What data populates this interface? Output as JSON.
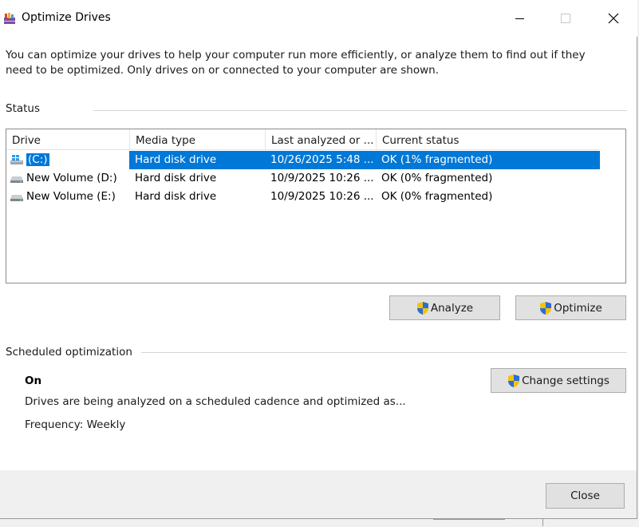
{
  "window": {
    "title": "Optimize Drives"
  },
  "intro": {
    "text": "You can optimize your drives to help your computer run more efficiently, or analyze them to find out if they need to be optimized. Only drives on or connected to your computer are shown."
  },
  "status": {
    "label": "Status",
    "columns": [
      "Drive",
      "Media type",
      "Last analyzed or ...",
      "Current status"
    ],
    "rows": [
      {
        "drive": "(C:)",
        "icon": "windows-drive-icon",
        "media": "Hard disk drive",
        "last": "10/26/2025 5:48 ...",
        "status": "OK (1% fragmented)",
        "selected": true
      },
      {
        "drive": "New Volume (D:)",
        "icon": "hard-drive-icon",
        "media": "Hard disk drive",
        "last": "10/9/2025 10:26 ...",
        "status": "OK (0% fragmented)",
        "selected": false
      },
      {
        "drive": "New Volume (E:)",
        "icon": "hard-drive-icon",
        "media": "Hard disk drive",
        "last": "10/9/2025 10:26 ...",
        "status": "OK (0% fragmented)",
        "selected": false
      }
    ]
  },
  "actions": {
    "analyze": "Analyze",
    "optimize": "Optimize"
  },
  "schedule": {
    "label": "Scheduled optimization",
    "state": "On",
    "description": "Drives are being analyzed on a scheduled cadence and optimized as...",
    "frequency": "Frequency: Weekly",
    "change_settings": "Change settings"
  },
  "footer": {
    "close": "Close"
  },
  "colors": {
    "selection": "#0078d7",
    "button_face": "#e1e1e1",
    "button_border": "#adadad"
  }
}
